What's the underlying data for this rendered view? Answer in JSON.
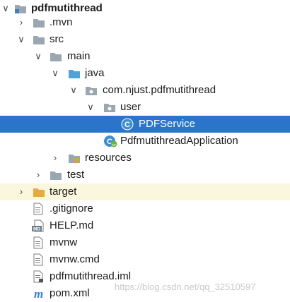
{
  "tree": {
    "project": "pdfmutithread",
    "mvn": ".mvn",
    "src": "src",
    "main": "main",
    "java": "java",
    "package": "com.njust.pdfmutithread",
    "user": "user",
    "pdfservice": "PDFService",
    "app": "PdfmutithreadApplication",
    "resources": "resources",
    "test": "test",
    "target": "target",
    "gitignore": ".gitignore",
    "help": "HELP.md",
    "mvnw": "mvnw",
    "mvnwcmd": "mvnw.cmd",
    "iml": "pdfmutithread.iml",
    "pom": "pom.xml"
  },
  "watermark": "https://blog.csdn.net/qq_32510597",
  "colors": {
    "selection": "#2a74c9",
    "target_row": "#fbf7de",
    "folder": "#9aa7b0",
    "java_folder": "#4fa3d9",
    "target_folder": "#e6a94a"
  },
  "icons": {
    "folder": "folder-icon",
    "source_folder": "source-folder-icon",
    "package": "package-icon",
    "class": "class-icon",
    "spring_class": "spring-boot-class-icon",
    "resources": "resources-folder-icon",
    "file": "text-file-icon",
    "markdown": "markdown-file-icon",
    "maven": "maven-icon"
  }
}
